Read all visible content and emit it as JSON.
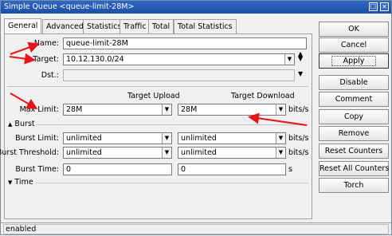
{
  "window": {
    "title": "Simple Queue <queue-limit-28M>",
    "buttons": [
      "☐",
      "✕"
    ]
  },
  "tabs": [
    {
      "label": "General"
    },
    {
      "label": "Advanced"
    },
    {
      "label": "Statistics"
    },
    {
      "label": "Traffic"
    },
    {
      "label": "Total"
    },
    {
      "label": "Total Statistics"
    }
  ],
  "form": {
    "name": {
      "label": "Name:",
      "value": "queue-limit-28M"
    },
    "target": {
      "label": "Target:",
      "value": "10.12.130.0/24"
    },
    "dst": {
      "label": "Dst.:",
      "value": ""
    },
    "col_upload": "Target Upload",
    "col_download": "Target Download",
    "max_limit": {
      "label": "Max Limit:",
      "upload": "28M",
      "download": "28M",
      "unit": "bits/s"
    },
    "burst_section": "Burst",
    "burst_limit": {
      "label": "Burst Limit:",
      "upload": "unlimited",
      "download": "unlimited",
      "unit": "bits/s"
    },
    "burst_threshold": {
      "label": "Burst Threshold:",
      "upload": "unlimited",
      "download": "unlimited",
      "unit": "bits/s"
    },
    "burst_time": {
      "label": "Burst Time:",
      "upload": "0",
      "download": "0",
      "unit": "s"
    },
    "time_section": "Time"
  },
  "buttons": {
    "ok": "OK",
    "cancel": "Cancel",
    "apply": "Apply",
    "disable": "Disable",
    "comment": "Comment",
    "copy": "Copy",
    "remove": "Remove",
    "reset_counters": "Reset Counters",
    "reset_all_counters": "Reset All Counters",
    "torch": "Torch"
  },
  "status": "enabled",
  "annotation_color": "#e8141b"
}
